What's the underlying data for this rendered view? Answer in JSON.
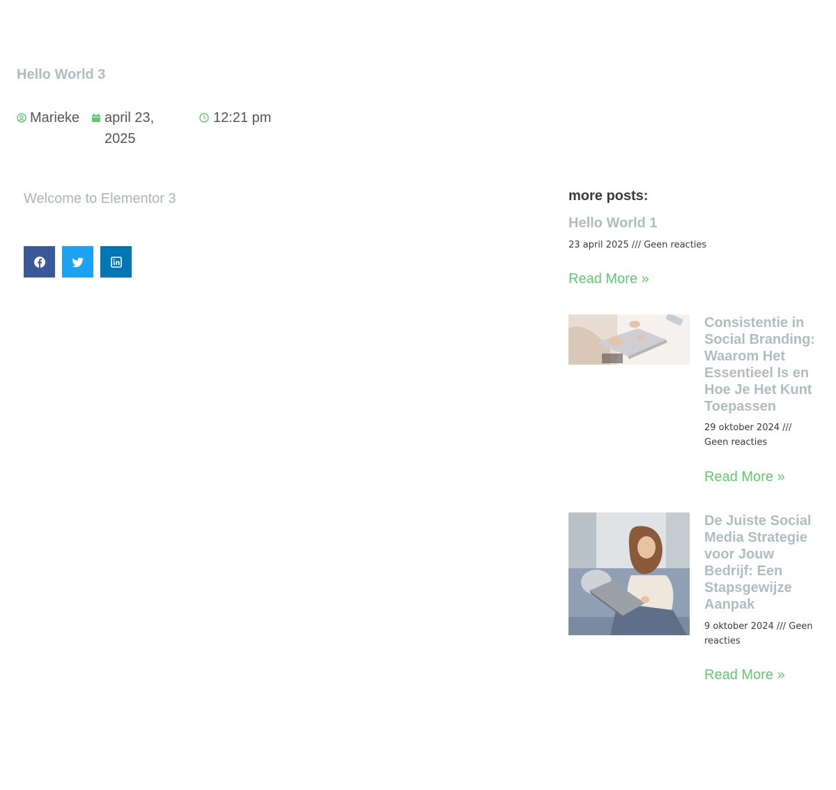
{
  "post": {
    "title": "Hello World 3",
    "author": "Marieke",
    "date": "april 23, 2025",
    "time": "12:21 pm",
    "intro": "Welcome to Elementor 3"
  },
  "share": {
    "items": [
      {
        "network": "facebook",
        "icon": "facebook-icon",
        "color": "#3b5998"
      },
      {
        "network": "twitter",
        "icon": "twitter-icon",
        "color": "#1da1f2"
      },
      {
        "network": "linkedin",
        "icon": "linkedin-icon",
        "color": "#0077b5"
      }
    ]
  },
  "sidebar": {
    "heading": "more posts:",
    "posts": [
      {
        "title": "Hello World 1",
        "meta": "23 april 2025 /// Geen reacties",
        "read_more": "Read More »"
      },
      {
        "title": "Consistentie in Social Branding: Waarom Het Essentieel Is en Hoe Je Het Kunt Toepassen",
        "meta": "29 oktober 2024 /// Geen reacties",
        "read_more": "Read More »",
        "image": "laptop-hands-photo"
      },
      {
        "title": "De Juiste Social Media Strategie voor Jouw Bedrijf: Een Stapsgewijze Aanpak",
        "meta": "9 oktober 2024 /// Geen reacties",
        "read_more": "Read More »",
        "image": "woman-on-sofa-photo"
      }
    ]
  },
  "colors": {
    "accent": "#5ecb6b",
    "title_muted": "#b3bcbd",
    "heading": "#3a3a3a"
  }
}
